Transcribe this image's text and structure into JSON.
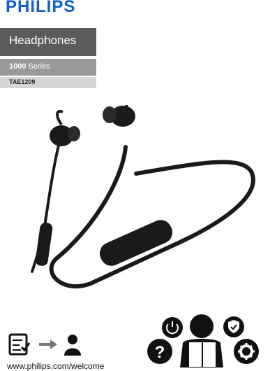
{
  "label": {
    "brand": "PHILIPS",
    "product": "Headphones",
    "series_number": "1000",
    "series_word": "Series",
    "model": "TAE1209"
  },
  "footer": {
    "url": "www.philips.com/welcome"
  },
  "colors": {
    "brand_blue": "#0b5ed7",
    "dark_grey": "#5b5b5b",
    "mid_grey": "#9a9a9a",
    "light_grey": "#d6d6d6",
    "product_black": "#1a1a1a"
  },
  "icons": [
    "checklist-icon",
    "arrow-right-icon",
    "person-icon",
    "power-icon",
    "help-icon",
    "reading-person-icon",
    "shield-check-icon",
    "gear-icon"
  ]
}
